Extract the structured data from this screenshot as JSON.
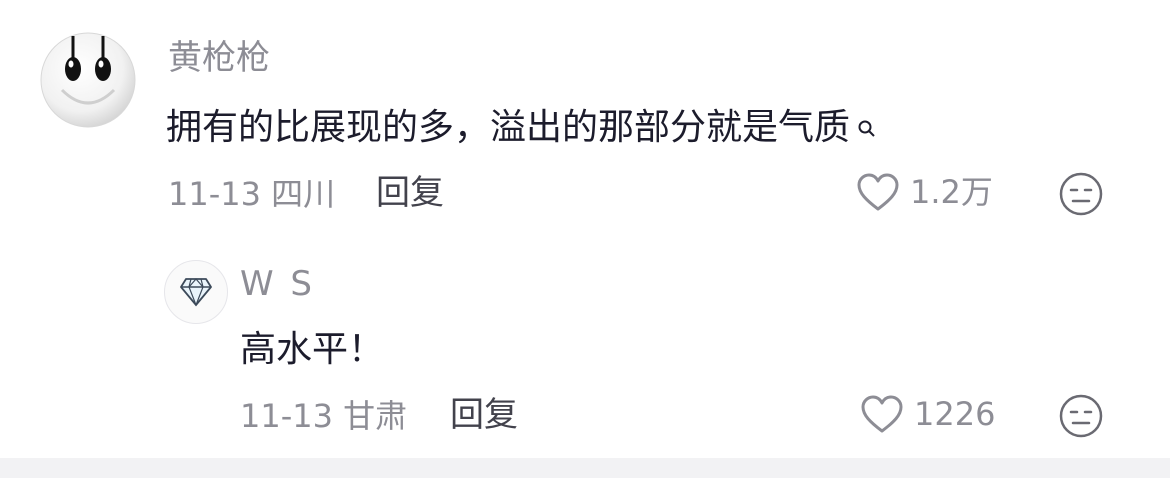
{
  "comment": {
    "username": "黄枪枪",
    "text": "拥有的比展现的多，溢出的那部分就是气质",
    "date": "11-13",
    "location": "四川",
    "reply_label": "回复",
    "like_count": "1.2万",
    "avatar_icon": "smiley-face-icon"
  },
  "reply": {
    "username": "W S",
    "text": "高水平！",
    "date": "11-13",
    "location": "甘肃",
    "reply_label": "回复",
    "like_count": "1226",
    "avatar_icon": "diamond-icon"
  },
  "colors": {
    "username": "#8d8d95",
    "text": "#1c1c2c",
    "meta": "#8d8d95",
    "reply": "#42424c",
    "icon_stroke": "#8d8d95"
  }
}
